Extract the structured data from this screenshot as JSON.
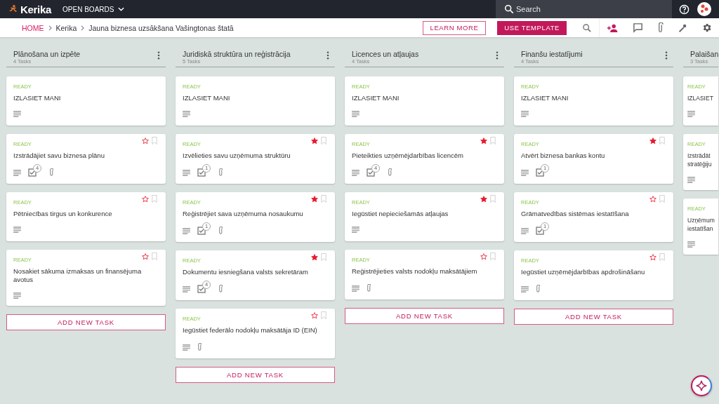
{
  "topbar": {
    "logo": "Kerika",
    "menu": "OPEN BOARDS",
    "search": {
      "placeholder": "Search"
    }
  },
  "breadcrumb": [
    "HOME",
    "Kerika",
    "Jauna biznesa uzsākšana Vašingtonas štatā"
  ],
  "actions": {
    "learn_more": "LEARN MORE",
    "use_template": "USE TEMPLATE"
  },
  "columns": [
    {
      "title": "Plānošana un izpēte",
      "count": "4 Tasks",
      "add_label": "ADD NEW TASK",
      "cards": [
        {
          "status": "READY",
          "title": "IZLASIET MANI"
        },
        {
          "status": "READY",
          "title": "Izstrādājiet savu biznesa plānu",
          "starred": false,
          "checklist": "4",
          "attachment": true
        },
        {
          "status": "READY",
          "title": "Pētniecības tirgus un konkurence",
          "starred": false,
          "attachment": false
        },
        {
          "status": "READY",
          "title": "Nosakiet sākuma izmaksas un finansējuma avotus",
          "starred": false,
          "attachment": false
        }
      ]
    },
    {
      "title": "Juridiskā struktūra un reģistrācija",
      "count": "5 Tasks",
      "add_label": "ADD NEW TASK",
      "cards": [
        {
          "status": "READY",
          "title": "IZLASIET MANI"
        },
        {
          "status": "READY",
          "title": "Izvēlieties savu uzņēmuma struktūru",
          "starred": true,
          "checklist": "1",
          "attachment": true
        },
        {
          "status": "READY",
          "title": "Reģistrējiet sava uzņēmuma nosaukumu",
          "starred": true,
          "checklist": "1",
          "attachment": true
        },
        {
          "status": "READY",
          "title": "Dokumentu iesniegšana valsts sekretāram",
          "starred": true,
          "checklist": "4",
          "attachment": true
        },
        {
          "status": "READY",
          "title": "Iegūstiet federālo nodokļu maksātāja ID (EIN)",
          "starred": false,
          "attachment": true
        }
      ]
    },
    {
      "title": "Licences un atļaujas",
      "count": "4 Tasks",
      "add_label": "ADD NEW TASK",
      "cards": [
        {
          "status": "READY",
          "title": "IZLASIET MANI"
        },
        {
          "status": "READY",
          "title": "Pieteikties uzņēmējdarbības licencēm",
          "starred": true,
          "checklist": "4",
          "attachment": true
        },
        {
          "status": "READY",
          "title": "Iegūstiet nepieciešamās atļaujas",
          "starred": true,
          "attachment": false
        },
        {
          "status": "READY",
          "title": "Reģistrējieties valsts nodokļu maksātājiem",
          "starred": false,
          "attachment": true
        }
      ]
    },
    {
      "title": "Finanšu iestatījumi",
      "count": "4 Tasks",
      "add_label": "ADD NEW TASK",
      "cards": [
        {
          "status": "READY",
          "title": "IZLASIET MANI"
        },
        {
          "status": "READY",
          "title": "Atvērt biznesa bankas kontu",
          "starred": true,
          "checklist": "1",
          "attachment": false
        },
        {
          "status": "READY",
          "title": "Grāmatvedības sistēmas iestatīšana",
          "starred": false,
          "checklist": "1",
          "attachment": false
        },
        {
          "status": "READY",
          "title": "Iegūstiet uzņēmējdarbības apdrošināšanu",
          "starred": false,
          "attachment": true
        }
      ]
    },
    {
      "title": "Palaišan",
      "count": "3 Tasks",
      "cards": [
        {
          "status": "READY",
          "title": "IZLASIET"
        },
        {
          "status": "READY",
          "title": "Izstrādāt stratēģiju",
          "attachment": false
        },
        {
          "status": "READY",
          "title": "Uzņēmum iestatīšan",
          "attachment": false
        }
      ]
    }
  ]
}
